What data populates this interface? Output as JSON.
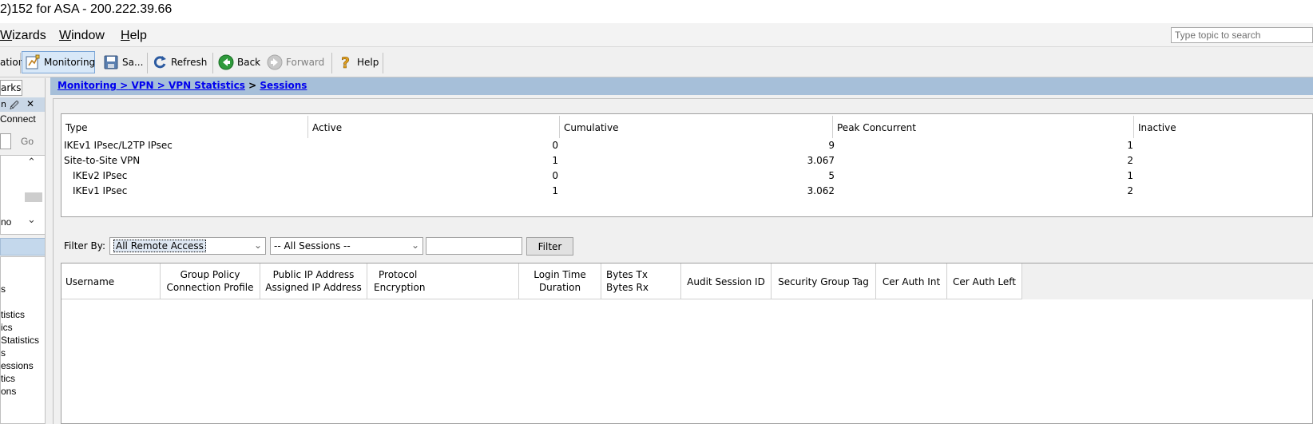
{
  "window": {
    "title": "2)152 for ASA - 200.222.39.66"
  },
  "menu": {
    "items": [
      {
        "label": "Wizards",
        "underline": "W"
      },
      {
        "label": "Window",
        "underline": "W"
      },
      {
        "label": "Help",
        "underline": "H"
      }
    ],
    "search_placeholder": "Type topic to search"
  },
  "toolbar": {
    "config_label": "ation",
    "monitoring_label": "Monitoring",
    "save_label": "Sa...",
    "refresh_label": "Refresh",
    "back_label": "Back",
    "forward_label": "Forward",
    "help_label": "Help"
  },
  "left_panel": {
    "tab_label": "arks",
    "connect_label": "Connect",
    "go_label": "Go",
    "list_item": "no",
    "tree_items": [
      "s",
      "tistics",
      "ics",
      " Statistics",
      "s",
      "essions",
      "tics",
      "ons"
    ]
  },
  "breadcrumb": {
    "parts": [
      "Monitoring",
      "VPN",
      "VPN Statistics",
      "Sessions"
    ],
    "separator": ">"
  },
  "stats_table": {
    "headers": [
      "Type",
      "Active",
      "Cumulative",
      "Peak Concurrent",
      "Inactive"
    ],
    "rows": [
      {
        "type": "IKEv1 IPsec/L2TP IPsec",
        "active": "0",
        "cumulative": "9",
        "peak": "1",
        "inactive": ""
      },
      {
        "type": "Site-to-Site VPN",
        "active": "1",
        "cumulative": "3.067",
        "peak": "2",
        "inactive": ""
      },
      {
        "type": "IKEv2 IPsec",
        "active": "0",
        "cumulative": "5",
        "peak": "1",
        "inactive": ""
      },
      {
        "type": "IKEv1 IPsec",
        "active": "1",
        "cumulative": "3.062",
        "peak": "2",
        "inactive": ""
      }
    ]
  },
  "filter": {
    "label": "Filter By:",
    "type_value": "All Remote Access",
    "session_value": "-- All Sessions --",
    "text_value": "",
    "button_label": "Filter"
  },
  "sessions_table": {
    "headers": [
      {
        "line1": "Username",
        "line2": ""
      },
      {
        "line1": "Group Policy",
        "line2": "Connection Profile"
      },
      {
        "line1": "Public IP Address",
        "line2": "Assigned IP Address"
      },
      {
        "line1": "Protocol",
        "line2": "Encryption"
      },
      {
        "line1": "Login Time",
        "line2": "Duration"
      },
      {
        "line1": "Bytes Tx",
        "line2": "Bytes Rx"
      },
      {
        "line1": "Audit Session ID",
        "line2": ""
      },
      {
        "line1": "Security Group Tag",
        "line2": ""
      },
      {
        "line1": "Cer Auth Int",
        "line2": ""
      },
      {
        "line1": "Cer Auth Left",
        "line2": ""
      }
    ],
    "rows": []
  },
  "colors": {
    "breadcrumb_bg": "#a6bfd9",
    "link": "#0000ee",
    "active_tool_bg": "#d8e8f8"
  }
}
